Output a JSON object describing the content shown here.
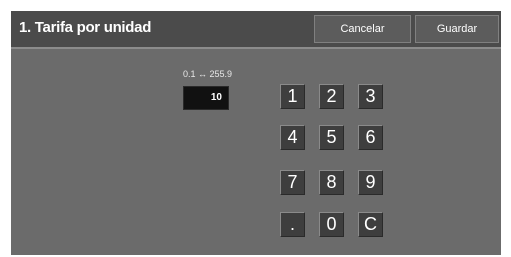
{
  "header": {
    "title": "1. Tarifa por unidad",
    "cancel_label": "Cancelar",
    "save_label": "Guardar"
  },
  "input": {
    "range_label": "0.1 ↔ 255.9",
    "value": "10"
  },
  "keypad": {
    "keys": [
      "1",
      "2",
      "3",
      "4",
      "5",
      "6",
      "7",
      "8",
      "9",
      ".",
      "0",
      "C"
    ]
  },
  "colors": {
    "header_bg": "#4b4b4b",
    "panel_bg": "#6b6b6b",
    "key_bg": "#3e3e3e",
    "field_bg": "#111111",
    "text": "#ffffff"
  }
}
